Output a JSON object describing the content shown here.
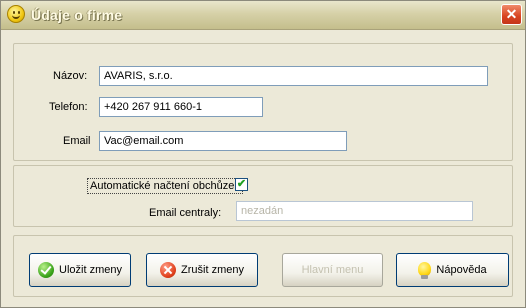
{
  "window": {
    "title": "Údaje o firme",
    "close_glyph": "✕"
  },
  "form": {
    "name_label": "Názov:",
    "name_value": "AVARIS, s.r.o.",
    "phone_label": "Telefon:",
    "phone_value": "+420 267 911 660-1",
    "email_label": "Email",
    "email_value": "Vac@email.com",
    "auto_load_label": "Automatické načtení obchůzek",
    "auto_load_checked": true,
    "central_email_label": "Email centraly:",
    "central_email_value": "nezadán"
  },
  "buttons": {
    "save": {
      "label": "Uložit zmeny",
      "icon": "check-icon"
    },
    "cancel": {
      "label": "Zrušit zmeny",
      "icon": "x-icon"
    },
    "send": {
      "label": "Hlavní menu",
      "enabled": false
    },
    "help": {
      "label": "Nápovĕda",
      "icon": "bulb-icon"
    }
  },
  "colors": {
    "title_bar": "#c4be8c",
    "close_button": "#d8431f",
    "dialog_bg": "#ece9d8",
    "field_border": "#7f9db9"
  }
}
